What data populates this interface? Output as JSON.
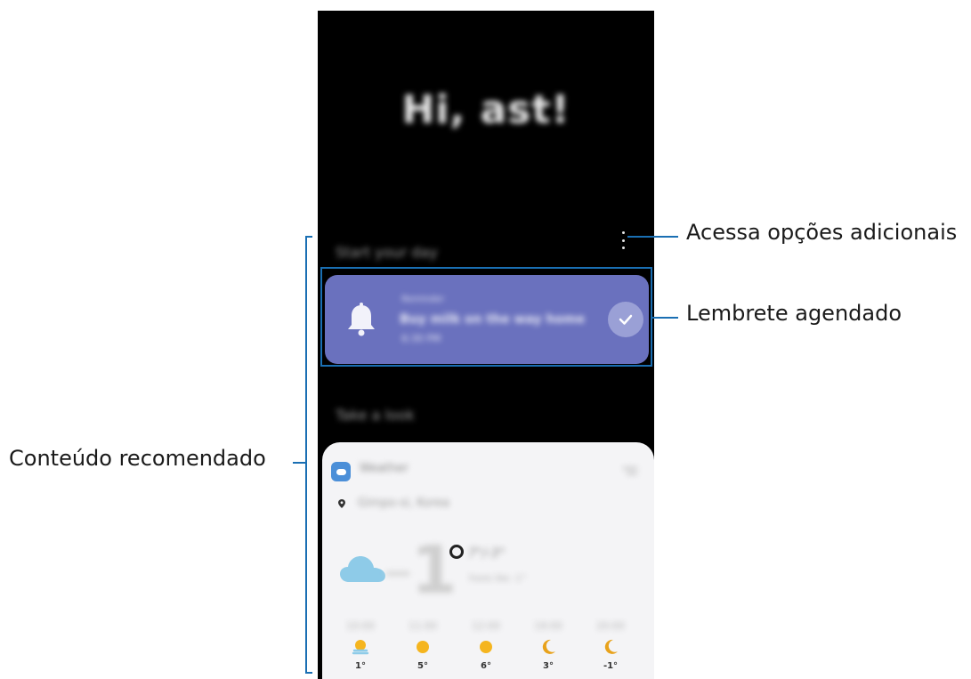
{
  "greeting": "Hi, ast!",
  "sections": {
    "start_day": "Start your day",
    "take_look": "Take a look"
  },
  "reminder": {
    "category": "Reminder",
    "title": "Buy milk on the way home",
    "time": "6:30 PM"
  },
  "weather": {
    "app_name": "Weather",
    "location": "Gimpo-si, Korea",
    "current_temp": "1",
    "range": "7°/-3°",
    "feels_like": "Feels like -1°",
    "forecast": [
      {
        "time": "10:00",
        "temp": "1°",
        "icon": "partly-cloudy-icon"
      },
      {
        "time": "11:00",
        "temp": "5°",
        "icon": "sun-icon"
      },
      {
        "time": "12:00",
        "temp": "6°",
        "icon": "sun-icon"
      },
      {
        "time": "19:00",
        "temp": "3°",
        "icon": "moon-icon"
      },
      {
        "time": "20:00",
        "temp": "-1°",
        "icon": "moon-icon"
      }
    ]
  },
  "callouts": {
    "more_options": "Acessa opções adicionais",
    "reminder": "Lembrete agendado",
    "recommended": "Conteúdo recomendado"
  },
  "colors": {
    "callout_line": "#1a6fb3",
    "reminder_card": "#6a71be",
    "weather_card": "#f4f4f6",
    "sun": "#f5b51f",
    "moon": "#e8a21b",
    "cloud": "#8ecbe8"
  }
}
